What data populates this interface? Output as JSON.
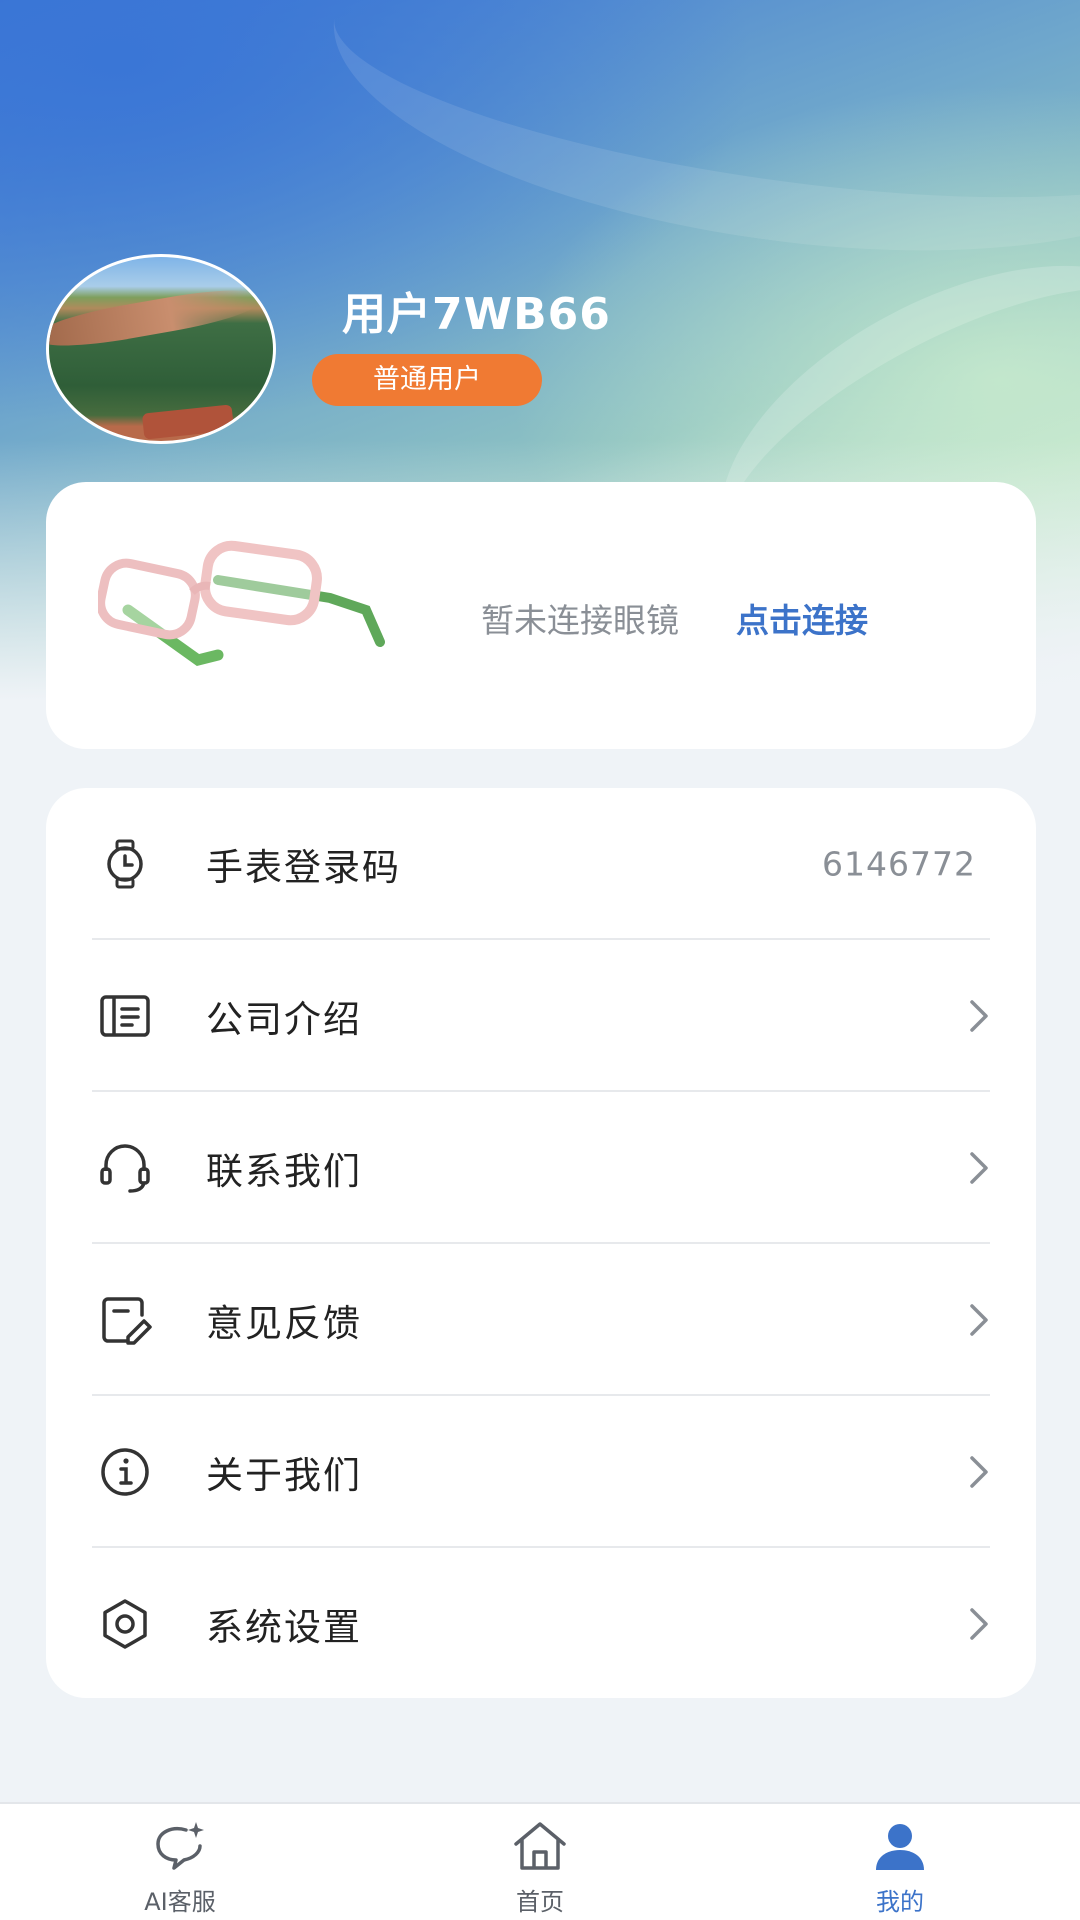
{
  "profile": {
    "username": "用户7WB66",
    "badge": "普通用户"
  },
  "device": {
    "status_text": "暂未连接眼镜",
    "connect_label": "点击连接",
    "image_icon": "glasses-image"
  },
  "menu": {
    "items": [
      {
        "icon": "watch-icon",
        "label": "手表登录码",
        "value": "6146772"
      },
      {
        "icon": "company-doc-icon",
        "label": "公司介绍"
      },
      {
        "icon": "headset-icon",
        "label": "联系我们"
      },
      {
        "icon": "feedback-edit-icon",
        "label": "意见反馈"
      },
      {
        "icon": "info-icon",
        "label": "关于我们"
      },
      {
        "icon": "settings-gear-icon",
        "label": "系统设置"
      }
    ]
  },
  "nav": {
    "items": [
      {
        "icon": "ai-chat-icon",
        "label": "AI客服"
      },
      {
        "icon": "home-icon",
        "label": "首页"
      },
      {
        "icon": "profile-icon",
        "label": "我的"
      }
    ],
    "active_index": 2
  },
  "colors": {
    "accent_blue": "#3c73c9",
    "badge_orange": "#f07a33"
  }
}
